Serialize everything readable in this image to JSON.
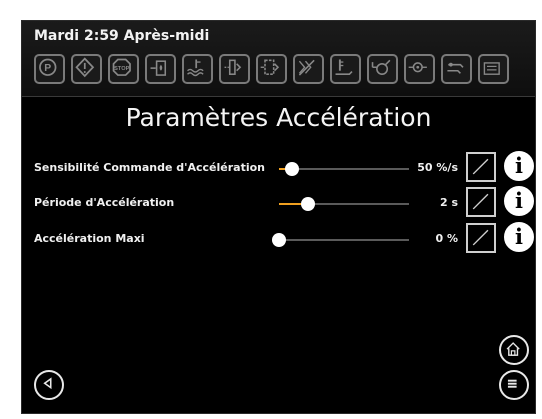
{
  "status_bar": {
    "datetime": "Mardi 2:59 Après-midi",
    "indicators": [
      {
        "name": "parking-brake-icon"
      },
      {
        "name": "warning-icon"
      },
      {
        "name": "stop-icon"
      },
      {
        "name": "fuel-water-icon"
      },
      {
        "name": "coolant-level-icon"
      },
      {
        "name": "air-filter-icon"
      },
      {
        "name": "fuel-filter-icon"
      },
      {
        "name": "filter-bypass-icon"
      },
      {
        "name": "exhaust-temp-icon"
      },
      {
        "name": "hydraulic-icon"
      },
      {
        "name": "oil-pressure-icon"
      },
      {
        "name": "temperature-icon"
      },
      {
        "name": "battery-icon"
      }
    ]
  },
  "page": {
    "title": "Paramètres Accélération"
  },
  "settings": [
    {
      "label": "Sensibilité Commande d'Accélération",
      "value": "50 %/s",
      "level_percent": 10
    },
    {
      "label": "Période d'Accélération",
      "value": "2 s",
      "level_percent": 22
    },
    {
      "label": "Accélération Maxi",
      "value": "0 %",
      "level_percent": 0
    }
  ],
  "colors": {
    "accent": "#f0a020",
    "background": "#000000",
    "text": "#f0f0f0"
  }
}
